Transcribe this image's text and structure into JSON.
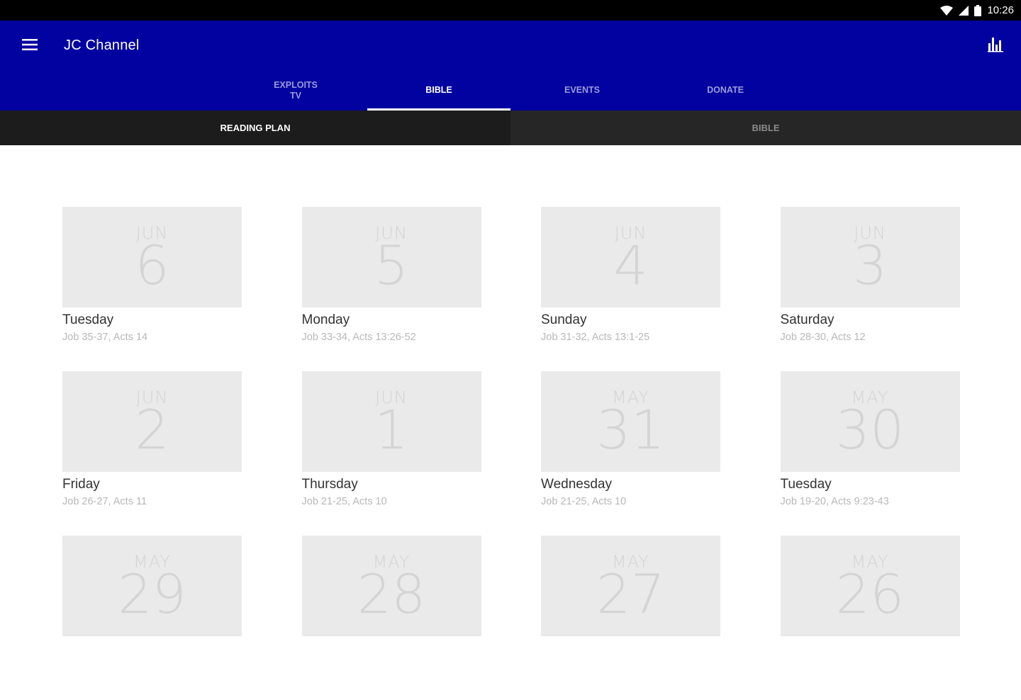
{
  "status_bar": {
    "time": "10:26"
  },
  "app_bar": {
    "title": "JC Channel",
    "tabs": [
      {
        "label": "EXPLOITS TV",
        "active": false
      },
      {
        "label": "BIBLE",
        "active": true
      },
      {
        "label": "EVENTS",
        "active": false
      },
      {
        "label": "DONATE",
        "active": false
      }
    ]
  },
  "sub_tabs": [
    {
      "label": "READING PLAN",
      "active": true
    },
    {
      "label": "BIBLE",
      "active": false
    }
  ],
  "reading_plan": [
    {
      "month": "JUN",
      "day": "6",
      "weekday": "Tuesday",
      "reading": "Job 35-37, Acts 14"
    },
    {
      "month": "JUN",
      "day": "5",
      "weekday": "Monday",
      "reading": "Job 33-34, Acts 13:26-52"
    },
    {
      "month": "JUN",
      "day": "4",
      "weekday": "Sunday",
      "reading": "Job 31-32, Acts 13:1-25"
    },
    {
      "month": "JUN",
      "day": "3",
      "weekday": "Saturday",
      "reading": "Job 28-30, Acts 12"
    },
    {
      "month": "JUN",
      "day": "2",
      "weekday": "Friday",
      "reading": "Job 26-27, Acts 11"
    },
    {
      "month": "JUN",
      "day": "1",
      "weekday": "Thursday",
      "reading": "Job 21-25, Acts 10"
    },
    {
      "month": "MAY",
      "day": "31",
      "weekday": "Wednesday",
      "reading": "Job 21-25, Acts 10"
    },
    {
      "month": "MAY",
      "day": "30",
      "weekday": "Tuesday",
      "reading": "Job 19-20, Acts 9:23-43"
    },
    {
      "month": "MAY",
      "day": "29",
      "weekday": "",
      "reading": ""
    },
    {
      "month": "MAY",
      "day": "28",
      "weekday": "",
      "reading": ""
    },
    {
      "month": "MAY",
      "day": "27",
      "weekday": "",
      "reading": ""
    },
    {
      "month": "MAY",
      "day": "26",
      "weekday": "",
      "reading": ""
    }
  ],
  "icons": {
    "menu": "menu-icon",
    "stats": "bar-chart-icon",
    "wifi": "wifi-icon",
    "signal": "signal-icon",
    "battery": "battery-icon"
  },
  "colors": {
    "app_bar": "#0202a0",
    "sub_tab_active": "#1c1c1c",
    "sub_tab_inactive": "#262626",
    "tile": "#eaeaea"
  }
}
